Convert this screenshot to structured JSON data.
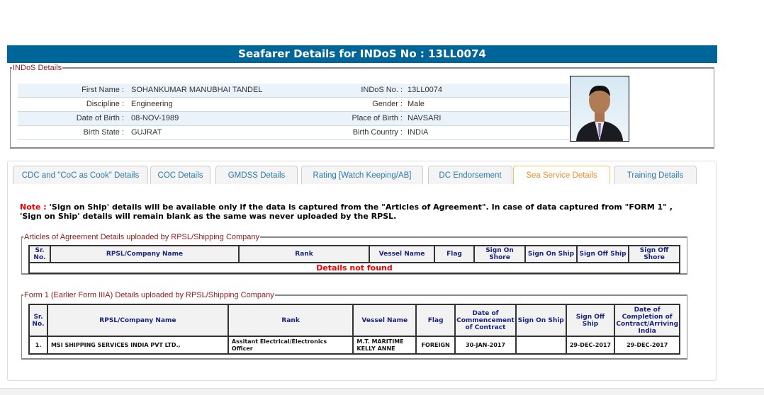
{
  "title": "Seafarer Details for INDoS No : 13LL0074",
  "indos": {
    "legend": "INDoS Details",
    "rows": [
      {
        "l1": "First Name :",
        "v1": "SOHANKUMAR MANUBHAI TANDEL",
        "l2": "INDoS No. :",
        "v2": "13LL0074"
      },
      {
        "l1": "Discipline :",
        "v1": "Engineering",
        "l2": "Gender :",
        "v2": "Male"
      },
      {
        "l1": "Date of Birth :",
        "v1": "08-NOV-1989",
        "l2": "Place of Birth :",
        "v2": "NAVSARI"
      },
      {
        "l1": "Birth State :",
        "v1": "GUJRAT",
        "l2": "Birth Country :",
        "v2": "INDIA"
      }
    ]
  },
  "tabs": [
    "CDC and \"CoC as Cook\" Details",
    "COC Details",
    "GMDSS Details",
    "Rating [Watch Keeping/AB]",
    "DC Endorsement",
    "Sea Service Details",
    "Training Details"
  ],
  "note": {
    "label": "Note :",
    "text": " 'Sign on Ship' details will be available only if the data is captured from the \"Articles of Agreement\". In case of data captured from \"FORM 1\" , 'Sign on Ship' details will remain blank as the same was never uploaded by the RPSL."
  },
  "aoa": {
    "legend": "Articles of Agreement Details uploaded by RPSL/Shipping Company",
    "headers": [
      "Sr. No.",
      "RPSL/Company Name",
      "Rank",
      "Vessel Name",
      "Flag",
      "Sign On Shore",
      "Sign On Ship",
      "Sign Off Ship",
      "Sign Off Shore"
    ],
    "empty": "Details not found"
  },
  "form1": {
    "legend": "Form 1 (Earlier Form IIIA) Details uploaded by RPSL/Shipping Company",
    "headers": [
      "Sr. No.",
      "RPSL/Company Name",
      "Rank",
      "Vessel Name",
      "Flag",
      "Date of Commencement of Contract",
      "Sign On Ship",
      "Sign Off Ship",
      "Date of Completion of Contract/Arriving India"
    ],
    "rows": [
      [
        "1.",
        "MSI SHIPPING SERVICES INDIA PVT LTD.,",
        "Assitant Electrical/Electronics Officer",
        "M.T. MARITIME KELLY ANNE",
        "FOREIGN",
        "30-JAN-2017",
        "",
        "29-DEC-2017",
        "29-DEC-2017"
      ]
    ]
  }
}
